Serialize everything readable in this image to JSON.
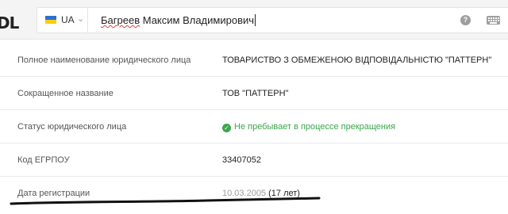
{
  "header": {
    "logo_fragment": "DL",
    "country_code": "UA",
    "search_query_part1": "Багреев",
    "search_query_part2": " Максим Владимирович",
    "help_glyph": "?"
  },
  "rows": [
    {
      "label": "Полное наименование юридического лица",
      "value": "ТОВАРИСТВО З ОБМЕЖЕНОЮ ВІДПОВІДАЛЬНІСТЮ \"ПАТТЕРН\""
    },
    {
      "label": "Сокращенное название",
      "value": "ТОВ \"ПАТТЕРН\""
    },
    {
      "label": "Статус юридического лица",
      "value": "Не пребывает в процессе прекращения",
      "status_color": "#3aa64a"
    },
    {
      "label": "Код ЕГРПОУ",
      "value": "33407052"
    },
    {
      "label": "Дата регистрации",
      "value_date": "10.03.2005",
      "value_age": " (17 лет)"
    }
  ]
}
